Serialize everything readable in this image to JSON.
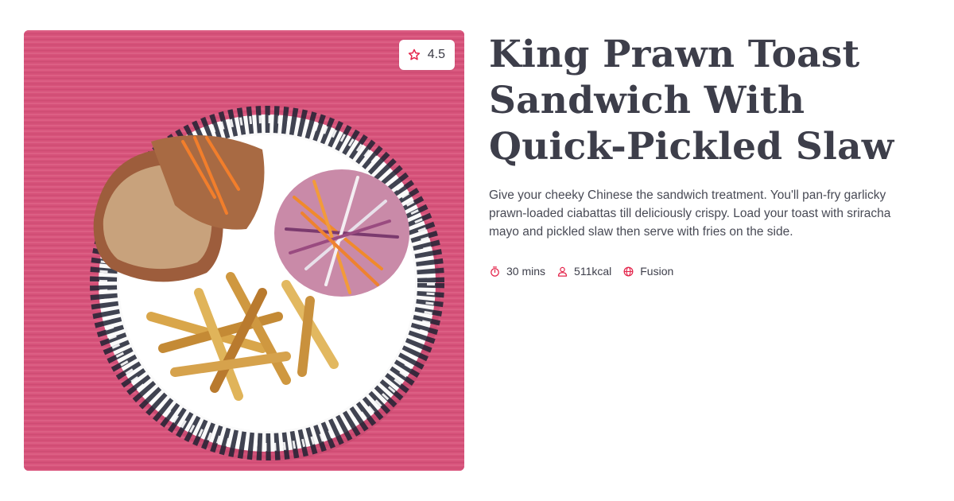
{
  "recipe": {
    "title": "King Prawn Toast Sandwich With Quick-Pickled Slaw",
    "description": "Give your cheeky Chinese the sandwich treatment. You'll pan-fry garlicky prawn-loaded ciabattas till deliciously crispy. Load your toast with sriracha mayo and pickled slaw then serve with fries on the side.",
    "rating": "4.5",
    "rating_icon": "star-icon",
    "meta": [
      {
        "icon": "stopwatch-icon",
        "label": "30 mins"
      },
      {
        "icon": "person-icon",
        "label": "511kcal"
      },
      {
        "icon": "globe-icon",
        "label": "Fusion"
      }
    ]
  },
  "colors": {
    "accent": "#e4264c",
    "title": "#3d3e4a",
    "text": "#484a55",
    "photo_background": "#d8567a"
  }
}
